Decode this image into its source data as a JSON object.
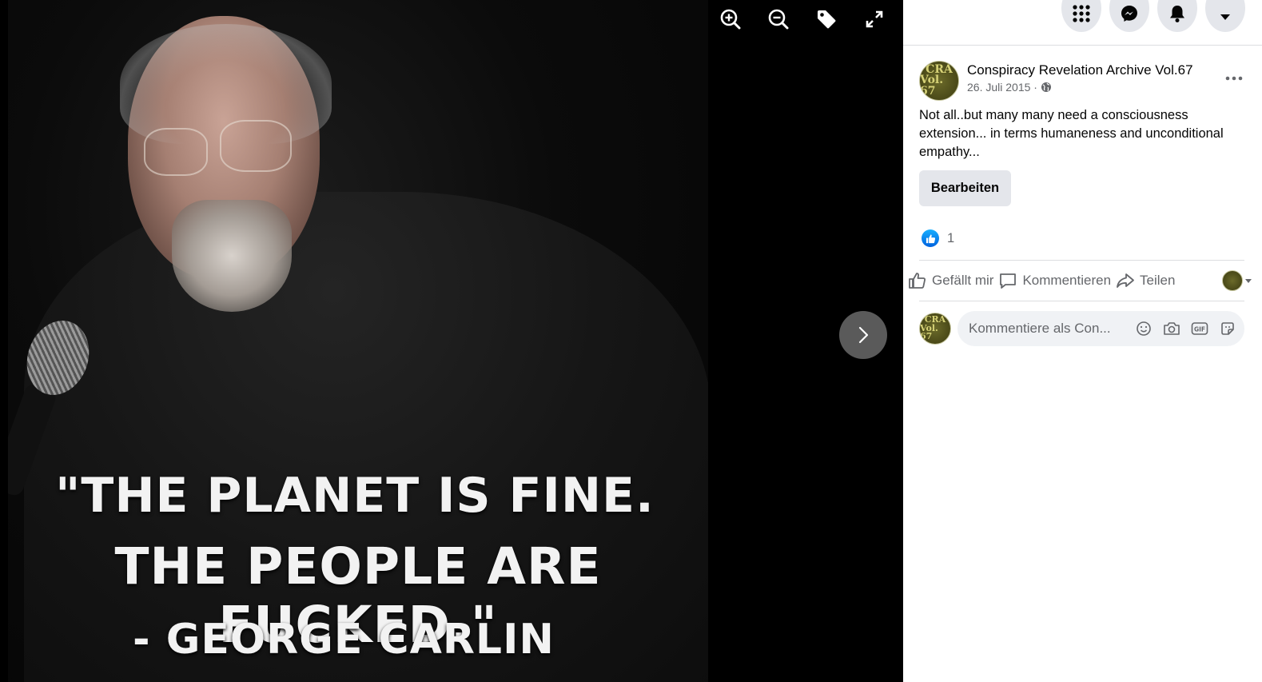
{
  "viewer": {
    "toolbar": {
      "zoom_in": "zoom-in-icon",
      "zoom_out": "zoom-out-icon",
      "tag": "tag-icon",
      "fullscreen": "fullscreen-icon"
    },
    "photo": {
      "quote_line_1": "\"THE PLANET IS FINE.",
      "quote_line_2": "THE PEOPLE ARE FUCKED.\"",
      "quote_line_3": "- GEORGE CARLIN"
    },
    "next": "chevron-right-icon"
  },
  "topbar": {
    "icons": [
      "menu-grid-icon",
      "messenger-icon",
      "notifications-bell-icon",
      "account-caret-icon"
    ]
  },
  "post": {
    "avatar_line_1": "CRA",
    "avatar_line_2": "Vol. 67",
    "page_name": "Conspiracy Revelation Archive Vol.67",
    "date": "26. Juli 2015 ·",
    "privacy_icon": "globe-icon",
    "text": "Not all..but many many need a consciousness extension... in terms humaneness and unconditional empathy...",
    "edit_label": "Bearbeiten",
    "reaction_count": "1",
    "actions": {
      "like": "Gefällt mir",
      "comment": "Kommentieren",
      "share": "Teilen"
    },
    "comment": {
      "placeholder": "Kommentiere als Con..."
    }
  },
  "colors": {
    "fb_blue": "#0866ff",
    "panel_bg": "#ffffff",
    "secondary_text": "#65676b",
    "button_grey": "#e4e6eb"
  }
}
